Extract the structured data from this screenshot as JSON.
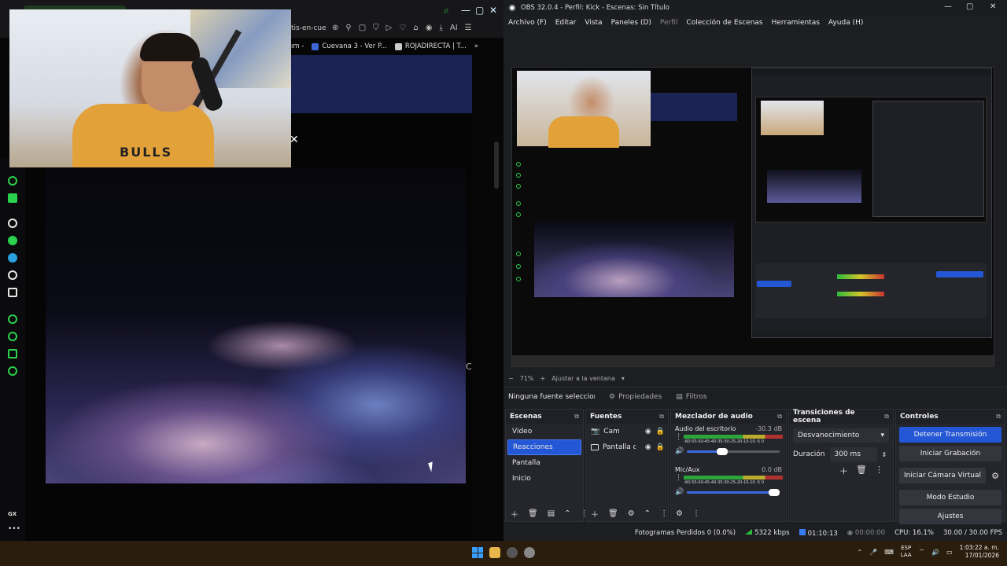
{
  "browser": {
    "address_fragment": "tis-en-cue",
    "bookmarks": [
      {
        "label": "ım -",
        "color": "#333333"
      },
      {
        "label": "Cuevana 3 - Ver P...",
        "color": "#3a66d6"
      },
      {
        "label": "ROJADIRECTA | T...",
        "color": "#cccccc"
      }
    ],
    "ai_label": "AI",
    "bookmark_more": "»",
    "webcam_shirt_text": "BULLS",
    "overlay_close": "✕",
    "sidebar_gx": "GX",
    "sidebar_more": "•••",
    "edge_letter": "C"
  },
  "obs": {
    "title": "OBS 32.0.4 - Perfil: Kick - Escenas: Sin Título",
    "menu": [
      {
        "label": "Archivo (F)",
        "dim": false
      },
      {
        "label": "Editar",
        "dim": false
      },
      {
        "label": "Vista",
        "dim": false
      },
      {
        "label": "Paneles (D)",
        "dim": false
      },
      {
        "label": "Perfil",
        "dim": true
      },
      {
        "label": "Colección de Escenas",
        "dim": false
      },
      {
        "label": "Herramientas",
        "dim": false
      },
      {
        "label": "Ayuda (H)",
        "dim": false
      }
    ],
    "zoom": "71%",
    "zoom_minus": "−",
    "zoom_plus": "+",
    "fit_label": "Ajustar a la ventana",
    "no_source": "Ninguna fuente seleccionada",
    "properties": "Propiedades",
    "filters": "Filtros",
    "docks": {
      "scenes": {
        "title": "Escenas",
        "items": [
          "Video",
          "Reacciones",
          "Pantalla",
          "Inicio"
        ],
        "selected": 1
      },
      "sources": {
        "title": "Fuentes",
        "items": [
          "Cam",
          "Pantalla completa"
        ]
      },
      "mixer": {
        "title": "Mezclador de audio",
        "channels": [
          {
            "name": "Audio del escritorio",
            "db": "-30.3 dB",
            "volume": 0.38
          },
          {
            "name": "Mic/Aux",
            "db": "0.0 dB",
            "volume": 1.0
          }
        ],
        "scale": "-60-55-50-45-40-35-30-25-20-15-10 -5  0"
      },
      "transitions": {
        "title": "Transiciones de escena",
        "selected": "Desvanecimiento",
        "duration_label": "Duración",
        "duration_value": "300 ms"
      },
      "controls": {
        "title": "Controles",
        "buttons": [
          "Detener Transmisión",
          "Iniciar Grabación",
          "Iniciar Cámara Virtual",
          "Modo Estudio",
          "Ajustes"
        ]
      }
    },
    "status": {
      "dropped": "Fotogramas Perdidos 0 (0.0%)",
      "kbps": "5322 kbps",
      "live_time": "01:10:13",
      "rec_time": "00:00:00",
      "cpu": "CPU: 16.1%",
      "fps": "30.00 / 30.00 FPS"
    }
  },
  "taskbar": {
    "lang_top": "ESP",
    "lang_bottom": "LAA",
    "time": "1:03:22 a. m.",
    "date": "17/01/2026"
  },
  "colors": {
    "accent_blue": "#2457d6",
    "opera_green": "#2bd14e",
    "meter_green": "#2dbb3c",
    "meter_yellow": "#d5c52b",
    "meter_red": "#c8342f"
  }
}
